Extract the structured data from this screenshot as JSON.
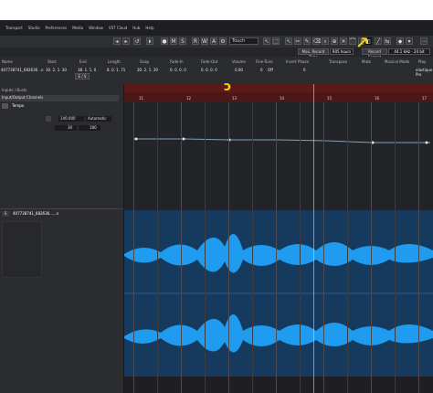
{
  "menu": [
    "Transport",
    "Studio",
    "Preferences",
    "Media",
    "Window",
    "VST Cloud",
    "Hub",
    "Help"
  ],
  "toolbar": {
    "buttons": [
      "M",
      "S",
      "R",
      "W",
      "A"
    ],
    "automation_mode": "Touch",
    "max_recent_time_label": "Max. Record Time",
    "max_recent_time_value": "605 hours",
    "record_format_label": "Record Format",
    "record_format_value": "44.1 kHz - 24 bit"
  },
  "info_headers": [
    "Name",
    "Start",
    "End",
    "Length",
    "Snap",
    "Fade-In",
    "Fade-Out",
    "Volume",
    "Fine-Tune",
    "Invert Phase",
    "Transpose",
    "Mute",
    "Musical Mode",
    "Play"
  ],
  "info_values": [
    "407738741_682636...n",
    "30. 2. 1. 30",
    "38. 1. 1. 0",
    "8. 0. 1. 71",
    "30. 2. 1. 30",
    "0. 0. 0. 0",
    "0. 0. 0. 0",
    "0.00",
    "0",
    "Off",
    "0",
    "",
    "",
    "elastique Pro"
  ],
  "inspector": {
    "hint_button": "E / S",
    "section_busts": "Inputs / Busts",
    "section_io": "Input/Output Channels",
    "tempo_track": "Tempo",
    "tempo_value": "140.000",
    "tempo_mode": "Automatic",
    "tempo_low": "30",
    "tempo_high": "180",
    "audio_track": "407738741_682636......n"
  },
  "ruler_bars": [
    "11",
    "12",
    "13",
    "14",
    "15",
    "16",
    "17"
  ],
  "annotations": [
    "↗",
    "ↄ"
  ]
}
